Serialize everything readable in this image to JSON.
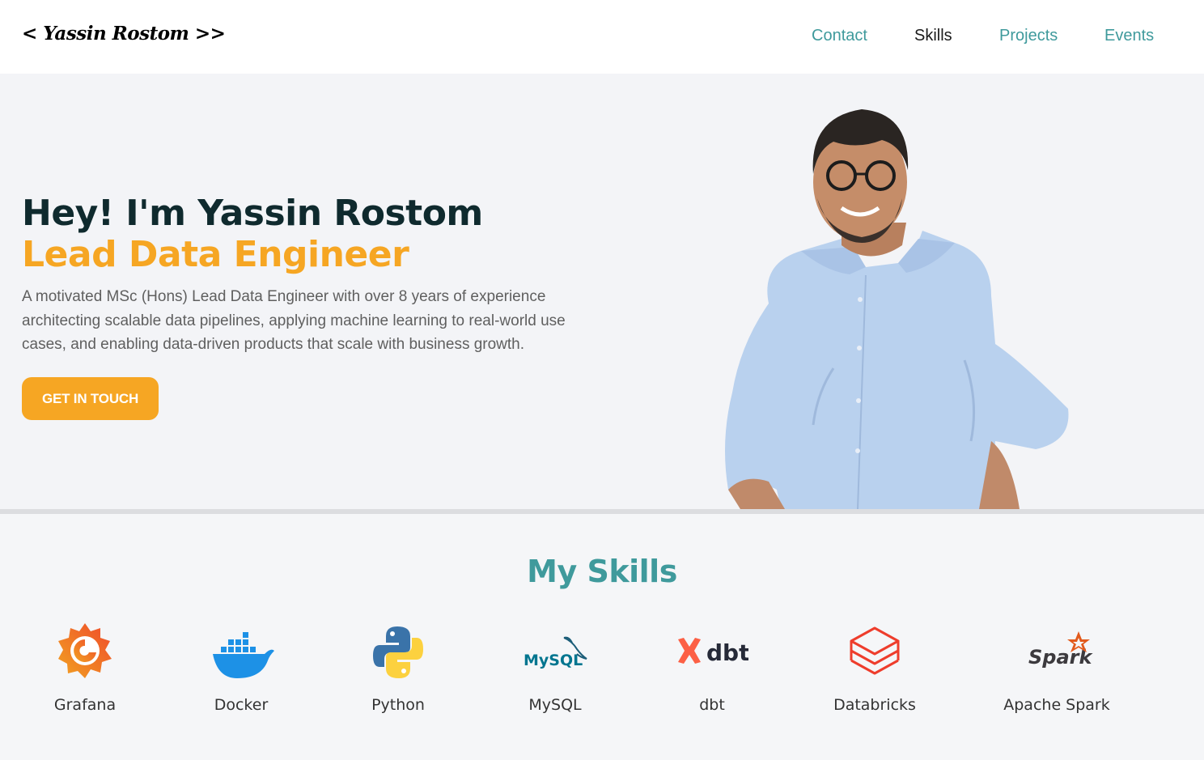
{
  "header": {
    "logo": "< Yassin Rostom >>",
    "nav": [
      {
        "label": "Contact"
      },
      {
        "label": "Skills"
      },
      {
        "label": "Projects"
      },
      {
        "label": "Events"
      }
    ]
  },
  "hero": {
    "greeting": "Hey! I'm Yassin Rostom",
    "role": "Lead Data Engineer",
    "description": "A motivated MSc (Hons) Lead Data Engineer with over 8 years of experience architecting scalable data pipelines, applying machine learning to real-world use cases, and enabling data-driven products that scale with business growth.",
    "cta_label": "GET IN TOUCH"
  },
  "skills": {
    "title": "My Skills",
    "items": [
      {
        "label": "Grafana",
        "icon": "grafana-icon"
      },
      {
        "label": "Docker",
        "icon": "docker-icon"
      },
      {
        "label": "Python",
        "icon": "python-icon"
      },
      {
        "label": "MySQL",
        "icon": "mysql-icon"
      },
      {
        "label": "dbt",
        "icon": "dbt-icon"
      },
      {
        "label": "Databricks",
        "icon": "databricks-icon"
      },
      {
        "label": "Apache Spark",
        "icon": "spark-icon"
      }
    ],
    "icon_text": {
      "mysql": "MySQL",
      "dbt": "dbt",
      "spark": "Spark"
    }
  },
  "colors": {
    "accent": "#3f9a9c",
    "orange": "#f6a623",
    "dark": "#0f2a2e"
  }
}
